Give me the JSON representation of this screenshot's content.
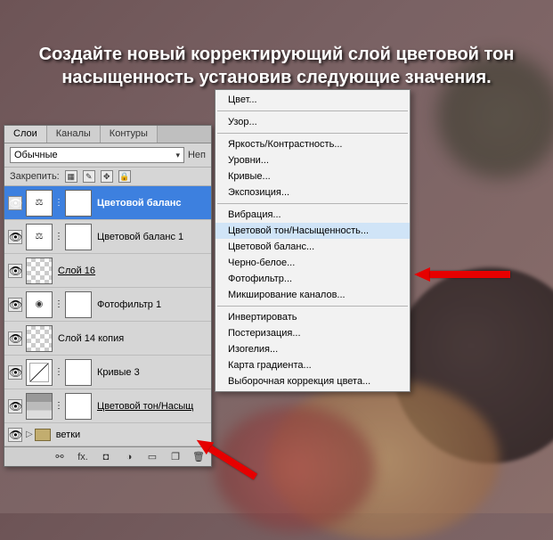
{
  "instruction_text": "Создайте новый корректирующий слой цветовой тон насыщенность установив следующие значения.",
  "panel": {
    "tabs": {
      "layers": "Слои",
      "channels": "Каналы",
      "paths": "Контуры"
    },
    "blend_mode": "Обычные",
    "opacity_label": "Неп",
    "lock_label": "Закрепить:",
    "layers": [
      {
        "name": "Цветовой баланс",
        "selected": true
      },
      {
        "name": "Цветовой баланс 1"
      },
      {
        "name": "Слой 16",
        "underline": true
      },
      {
        "name": "Фотофильтр 1"
      },
      {
        "name": "Слой 14 копия"
      },
      {
        "name": "Кривые 3"
      },
      {
        "name": "Цветовой тон/Насыщ",
        "underline": true
      }
    ],
    "folder_name": "ветки"
  },
  "menu": {
    "items": [
      {
        "type": "item",
        "label": "Цвет..."
      },
      {
        "type": "sep"
      },
      {
        "type": "item",
        "label": "Узор..."
      },
      {
        "type": "sep"
      },
      {
        "type": "item",
        "label": "Яркость/Контрастность..."
      },
      {
        "type": "item",
        "label": "Уровни..."
      },
      {
        "type": "item",
        "label": "Кривые..."
      },
      {
        "type": "item",
        "label": "Экспозиция..."
      },
      {
        "type": "sep"
      },
      {
        "type": "item",
        "label": "Вибрация..."
      },
      {
        "type": "item",
        "label": "Цветовой тон/Насыщенность...",
        "highlight": true
      },
      {
        "type": "item",
        "label": "Цветовой баланс..."
      },
      {
        "type": "item",
        "label": "Черно-белое..."
      },
      {
        "type": "item",
        "label": "Фотофильтр..."
      },
      {
        "type": "item",
        "label": "Микширование каналов..."
      },
      {
        "type": "sep"
      },
      {
        "type": "item",
        "label": "Инвертировать"
      },
      {
        "type": "item",
        "label": "Постеризация..."
      },
      {
        "type": "item",
        "label": "Изогелия..."
      },
      {
        "type": "item",
        "label": "Карта градиента..."
      },
      {
        "type": "item",
        "label": "Выборочная коррекция цвета..."
      }
    ]
  }
}
